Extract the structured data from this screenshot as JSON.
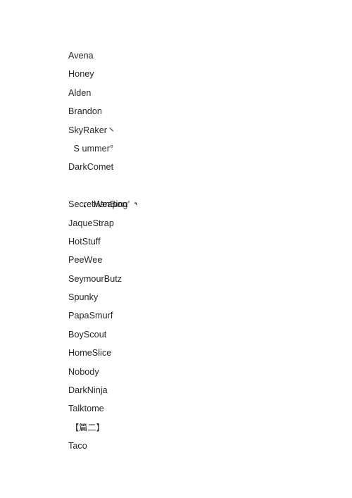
{
  "document": {
    "background_color": "#ffffff",
    "text_color": "#262626",
    "lines": [
      {
        "id": "line-1",
        "text": "Avena",
        "type": "name"
      },
      {
        "id": "line-2",
        "text": "Honey",
        "type": "name"
      },
      {
        "id": "line-3",
        "text": "Alden",
        "type": "name"
      },
      {
        "id": "line-4",
        "text": "Brandon",
        "type": "name"
      },
      {
        "id": "line-5",
        "text": "SkyRaker丶",
        "type": "name-decorated"
      },
      {
        "id": "line-6",
        "text": " S ummer°",
        "type": "name-decorated"
      },
      {
        "id": "line-7",
        "text": "DarkComet",
        "type": "name"
      },
      {
        "id": "line-8",
        "text": "⌞ ‘HanBing’ ⌝",
        "type": "name-bracketed",
        "parts": {
          "open": "⌞",
          "inner": "‘HanBing’",
          "close": "⌝"
        }
      },
      {
        "id": "line-9",
        "text": "SecretWeapon",
        "type": "name"
      },
      {
        "id": "line-10",
        "text": "JaqueStrap",
        "type": "name"
      },
      {
        "id": "line-11",
        "text": "HotStuff",
        "type": "name"
      },
      {
        "id": "line-12",
        "text": "PeeWee",
        "type": "name"
      },
      {
        "id": "line-13",
        "text": "SeymourButz",
        "type": "name"
      },
      {
        "id": "line-14",
        "text": "Spunky",
        "type": "name"
      },
      {
        "id": "line-15",
        "text": "PapaSmurf",
        "type": "name"
      },
      {
        "id": "line-16",
        "text": "BoyScout",
        "type": "name"
      },
      {
        "id": "line-17",
        "text": "HomeSlice",
        "type": "name"
      },
      {
        "id": "line-18",
        "text": "Nobody",
        "type": "name"
      },
      {
        "id": "line-19",
        "text": "DarkNinja",
        "type": "name"
      },
      {
        "id": "line-20",
        "text": "Talktome",
        "type": "name"
      },
      {
        "id": "line-21",
        "text": "【篇二】",
        "type": "section-heading"
      },
      {
        "id": "line-22",
        "text": "Taco",
        "type": "name"
      }
    ]
  }
}
